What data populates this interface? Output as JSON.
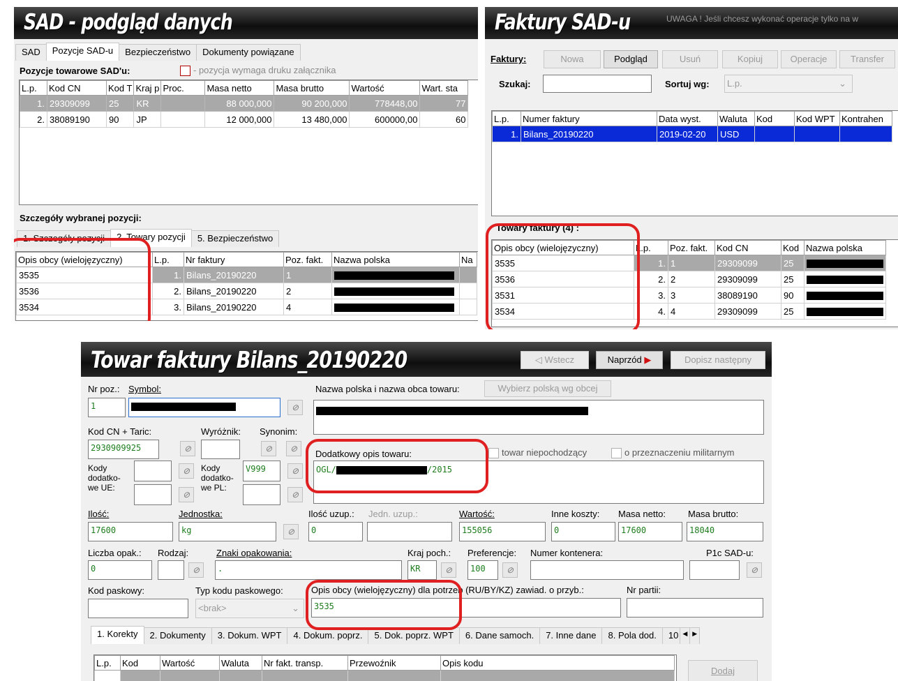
{
  "sad": {
    "title": "SAD - podgląd danych",
    "tabs": [
      "SAD",
      "Pozycje SAD-u",
      "Bezpieczeństwo",
      "Dokumenty powiązane"
    ],
    "positions_label": "Pozycje towarowe SAD'u:",
    "legend": "- pozycja wymaga druku załącznika",
    "columns": [
      "L.p.",
      "Kod CN",
      "Kod T",
      "Kraj p",
      "Proc.",
      "Masa netto",
      "Masa brutto",
      "Wartość",
      "Wart. sta"
    ],
    "rows": [
      [
        "1.",
        "29309099",
        "25",
        "KR",
        "",
        "88 000,000",
        "90 200,000",
        "778448,00",
        "77"
      ],
      [
        "2.",
        "38089190",
        "90",
        "JP",
        "",
        "12 000,000",
        "13 480,000",
        "600000,00",
        "60"
      ]
    ],
    "details_label": "Szczegóły wybranej pozycji:",
    "detail_tabs": [
      "1. Szczegóły pozycji",
      "2. Towary pozycji",
      "5. Bezpieczeństwo"
    ],
    "detail_columns": [
      "Opis obcy (wielojęzyczny)",
      "L.p.",
      "Nr faktury",
      "Poz. fakt.",
      "Nazwa polska",
      "Na"
    ],
    "detail_rows": [
      [
        "3535",
        "1.",
        "Bilans_20190220",
        "1"
      ],
      [
        "3536",
        "2.",
        "Bilans_20190220",
        "2"
      ],
      [
        "3534",
        "3.",
        "Bilans_20190220",
        "4"
      ]
    ]
  },
  "invoices": {
    "title": "Faktury SAD-u",
    "warning": "UWAGA ! Jeśli chcesz wykonać operacje tylko na w",
    "label": "Faktury:",
    "buttons": {
      "new": "Nowa",
      "preview": "Podgląd",
      "delete": "Usuń",
      "copy": "Kopiuj",
      "operations": "Operacje",
      "transfer": "Transfer"
    },
    "search_label": "Szukaj:",
    "sort_label": "Sortuj wg:",
    "sort_value": "L.p.",
    "columns": [
      "L.p.",
      "Numer faktury",
      "Data wyst.",
      "Waluta",
      "Kod",
      "Kod WPT",
      "Kontrahen"
    ],
    "rows": [
      [
        "1.",
        "Bilans_20190220",
        "2019-02-20",
        "USD",
        "",
        "",
        ""
      ]
    ],
    "goods_label": "Towary faktury (4) :",
    "goods_columns": [
      "Opis obcy (wielojęzyczny)",
      "L.p.",
      "Poz. fakt.",
      "Kod CN",
      "Kod",
      "Nazwa polska"
    ],
    "goods_rows": [
      [
        "3535",
        "1.",
        "1",
        "29309099",
        "25"
      ],
      [
        "3536",
        "2.",
        "2",
        "29309099",
        "25"
      ],
      [
        "3531",
        "3.",
        "3",
        "38089190",
        "90"
      ],
      [
        "3534",
        "4.",
        "4",
        "29309099",
        "25"
      ]
    ]
  },
  "goods": {
    "title": "Towar faktury Bilans_20190220",
    "back": "Wstecz",
    "next": "Naprzód",
    "append": "Dopisz następny",
    "nr_poz_label": "Nr poz.:",
    "symbol_label": "Symbol:",
    "nr_poz": "1",
    "name_label": "Nazwa polska i nazwa obca towaru:",
    "choose_polish": "Wybierz polską wg obcej",
    "kod_cn_label": "Kod CN + Taric:",
    "kod_cn": "2930909925",
    "wyroznik_label": "Wyróżnik:",
    "synonim_label": "Synonim:",
    "extra_desc_label": "Dodatkowy opis towaru:",
    "extra_desc_prefix": "OGL/",
    "extra_desc_suffix": "/2015",
    "non_origin": "towar niepochodzący",
    "military": "o przeznaczeniu militarnym",
    "codes_ue_label": "Kody dodatko-we UE:",
    "codes_pl_label": "Kody dodatko-we PL:",
    "codes_pl_value": "V999",
    "ilosc_label": "Ilość:",
    "ilosc": "17600",
    "jednostka_label": "Jednostka:",
    "jednostka": "kg",
    "ilosc_uzup_label": "Ilość uzup.:",
    "ilosc_uzup": "0",
    "jedn_uzup_label": "Jedn. uzup.:",
    "wartosc_label": "Wartość:",
    "wartosc": "155056",
    "inne_label": "Inne koszty:",
    "inne": "0",
    "netto_label": "Masa netto:",
    "netto": "17600",
    "brutto_label": "Masa brutto:",
    "brutto": "18040",
    "liczba_label": "Liczba opak.:",
    "liczba": "0",
    "rodzaj_label": "Rodzaj:",
    "znaki_label": "Znaki opakowania:",
    "znaki": ".",
    "kraj_label": "Kraj poch.:",
    "kraj": "KR",
    "pref_label": "Preferencje:",
    "pref": "100",
    "kontener_label": "Numer kontenera:",
    "p1c_label": "P1c SAD-u:",
    "kod_pask_label": "Kod paskowy:",
    "typ_kodu_label": "Typ kodu paskowego:",
    "typ_kodu": "<brak>",
    "opis_obcy_label": "Opis obcy (wielojęzyczny) dla potrzeb (RU/BY/KZ) zawiad. o przyb.:",
    "opis_obcy": "3535",
    "nr_partii_label": "Nr partii:",
    "tabs": [
      "1. Korekty",
      "2. Dokumenty",
      "3. Dokum. WPT",
      "4. Dokum. poprz.",
      "5. Dok. poprz. WPT",
      "6. Dane samoch.",
      "7. Inne dane",
      "8. Pola dod.",
      "10"
    ],
    "kor_columns": [
      "L.p.",
      "Kod",
      "Wartość",
      "Waluta",
      "Nr fakt. transp.",
      "Przewoźnik",
      "Opis kodu"
    ],
    "add": "Dodaj"
  },
  "colors": {
    "highlight_blue": "#0a2ad8",
    "selection_gray": "#a9a9a9",
    "annotation_red": "#e02020",
    "value_green": "#1e7d1e"
  }
}
